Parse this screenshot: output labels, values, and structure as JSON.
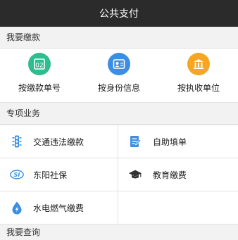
{
  "header": {
    "title": "公共支付"
  },
  "sections": {
    "payment": {
      "title": "我要缴款",
      "items": [
        {
          "label": "按缴款单号",
          "icon": "payment-slip-icon",
          "color": "#2dbd8f"
        },
        {
          "label": "按身份信息",
          "icon": "id-card-icon",
          "color": "#3a8fe2"
        },
        {
          "label": "按执收单位",
          "icon": "bank-building-icon",
          "color": "#f5a623"
        }
      ]
    },
    "special": {
      "title": "专项业务",
      "items": [
        {
          "label": "交通违法缴款",
          "icon": "traffic-light-icon"
        },
        {
          "label": "自助填单",
          "icon": "form-edit-icon"
        },
        {
          "label": "东阳社保",
          "icon": "social-insurance-icon"
        },
        {
          "label": "教育缴费",
          "icon": "graduation-cap-icon"
        },
        {
          "label": "水电燃气缴费",
          "icon": "utility-drop-icon"
        }
      ]
    },
    "query": {
      "title": "我要查询"
    }
  },
  "accent": "#3a8fe2"
}
